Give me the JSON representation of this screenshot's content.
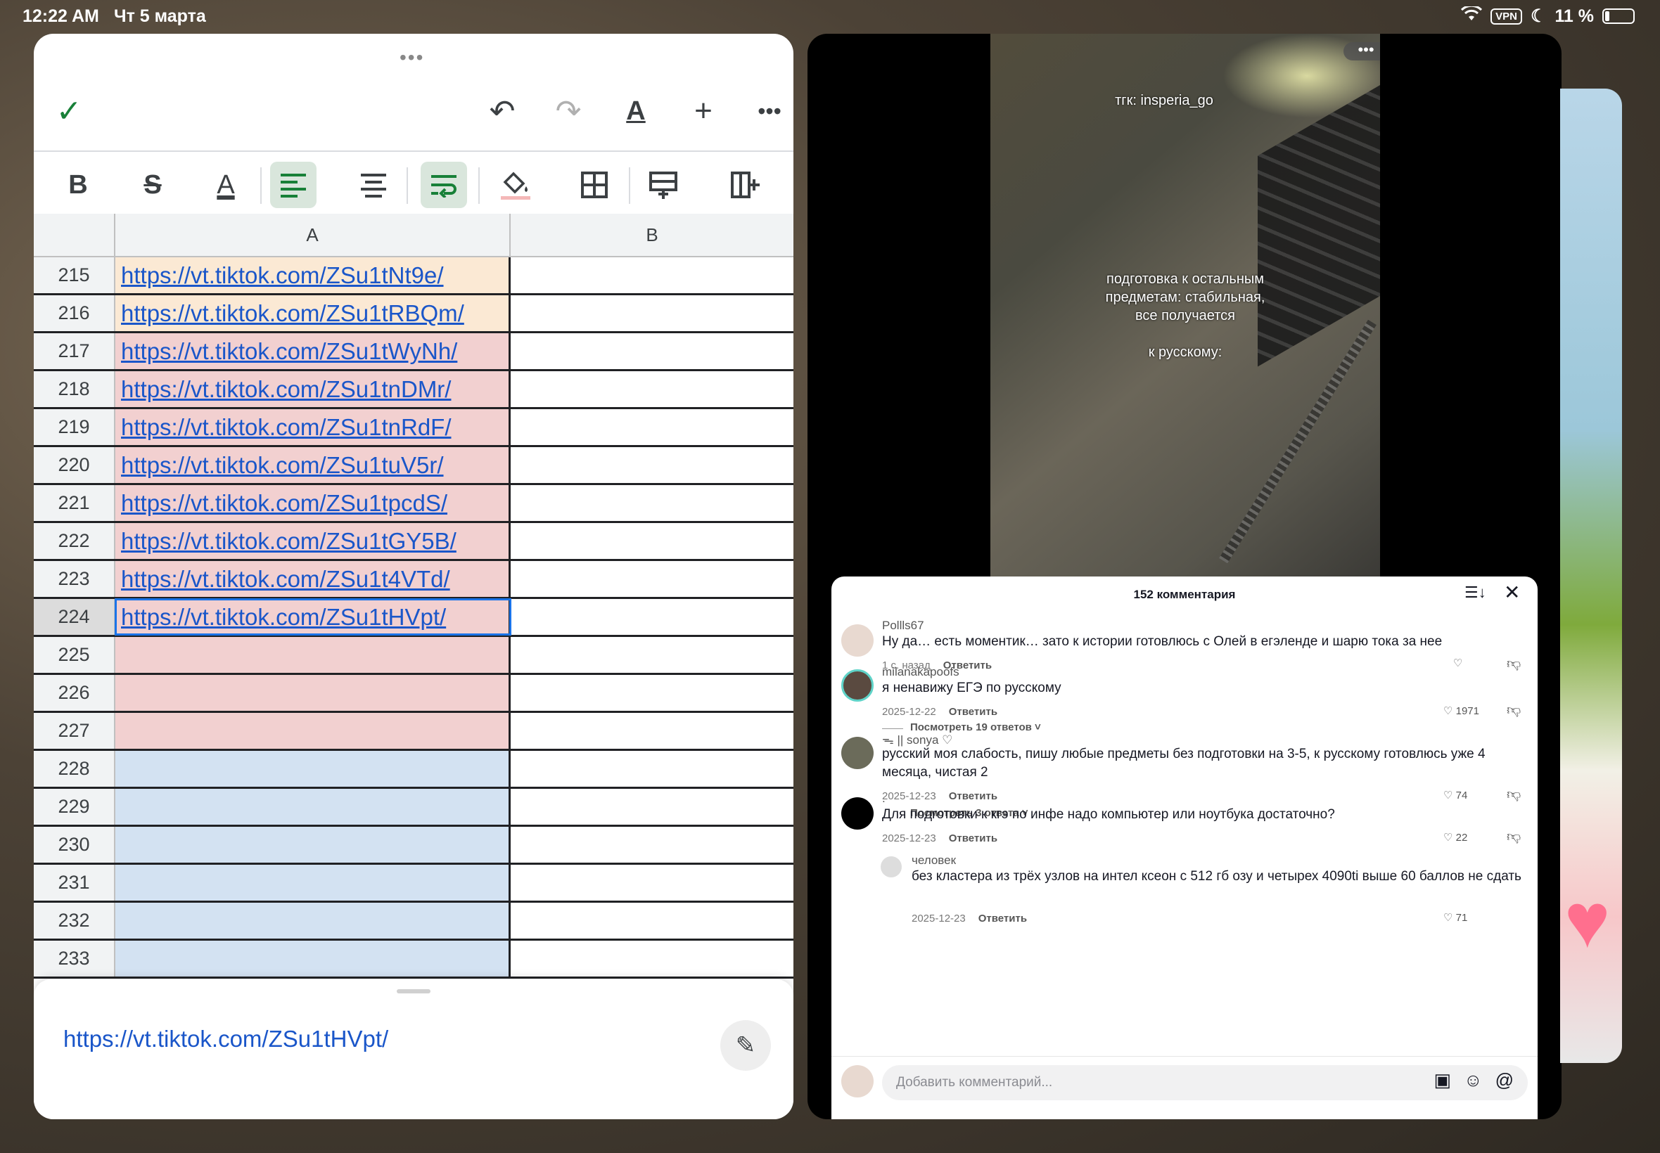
{
  "status": {
    "time": "12:22 AM",
    "date": "Чт 5 марта",
    "vpn": "VPN",
    "battery": "11 %"
  },
  "sheet": {
    "col_a": "A",
    "col_b": "B",
    "rows": [
      {
        "num": "215",
        "url": "https://vt.tiktok.com/ZSu1tNt9e/",
        "color": "#fbe9d4"
      },
      {
        "num": "216",
        "url": "https://vt.tiktok.com/ZSu1tRBQm/",
        "color": "#fbe9d4"
      },
      {
        "num": "217",
        "url": "https://vt.tiktok.com/ZSu1tWyNh/",
        "color": "#f2d0d0"
      },
      {
        "num": "218",
        "url": "https://vt.tiktok.com/ZSu1tnDMr/",
        "color": "#f2d0d0"
      },
      {
        "num": "219",
        "url": "https://vt.tiktok.com/ZSu1tnRdF/",
        "color": "#f2d0d0"
      },
      {
        "num": "220",
        "url": "https://vt.tiktok.com/ZSu1tuV5r/",
        "color": "#f2d0d0"
      },
      {
        "num": "221",
        "url": "https://vt.tiktok.com/ZSu1tpcdS/",
        "color": "#f2d0d0"
      },
      {
        "num": "222",
        "url": "https://vt.tiktok.com/ZSu1tGY5B/",
        "color": "#f2d0d0"
      },
      {
        "num": "223",
        "url": "https://vt.tiktok.com/ZSu1t4VTd/",
        "color": "#f2d0d0"
      },
      {
        "num": "224",
        "url": "https://vt.tiktok.com/ZSu1tHVpt/",
        "color": "#f2d0d0"
      },
      {
        "num": "225",
        "url": "",
        "color": "#f2d0d0"
      },
      {
        "num": "226",
        "url": "",
        "color": "#f2d0d0"
      },
      {
        "num": "227",
        "url": "",
        "color": "#f2d0d0"
      },
      {
        "num": "228",
        "url": "",
        "color": "#d3e2f2"
      },
      {
        "num": "229",
        "url": "",
        "color": "#d3e2f2"
      },
      {
        "num": "230",
        "url": "",
        "color": "#d3e2f2"
      },
      {
        "num": "231",
        "url": "",
        "color": "#d3e2f2"
      },
      {
        "num": "232",
        "url": "",
        "color": "#d3e2f2"
      },
      {
        "num": "233",
        "url": "",
        "color": "#d3e2f2"
      }
    ],
    "selected_row": "224",
    "cell_value": "https://vt.tiktok.com/ZSu1tHVpt/"
  },
  "video": {
    "watermark": "тгк: insperia_go",
    "caption_line1": "подготовка к остальным",
    "caption_line2": "предметам: стабильная,",
    "caption_line3": "все получается",
    "caption_line4": "к русскому:"
  },
  "comments": {
    "title": "152 комментария",
    "input_placeholder": "Добавить комментарий...",
    "reply_label": "Ответить",
    "items": [
      {
        "user": "Pollls67",
        "text": "Ну да… есть моментик… зато к истории готовлюсь с Олей в егэленде и шарю тока за нее",
        "date": "1 с. назад",
        "likes": ""
      },
      {
        "user": "milanakapoofs",
        "text": "я ненавижу ЕГЭ по русскому",
        "date": "2025-12-22",
        "likes": "1971",
        "more": "Посмотреть 19 ответов"
      },
      {
        "user": "ᯓ || sonya ♡",
        "text": "русский моя слабость, пишу любые предметы без подготовки на 3-5, к русскому готовлюсь уже 4 месяца, чистая 2",
        "date": "2025-12-23",
        "likes": "74",
        "more": "Посмотреть 3 ответа"
      },
      {
        "user": ".",
        "text": "Для подготовки к кгэ по инфе надо компьютер или ноутбука достаточно?",
        "date": "2025-12-23",
        "likes": "22"
      },
      {
        "user": "человек",
        "text": "без кластера из трёх узлов на интел ксеон с 512 гб озу и четырех 4090ti выше 60 баллов не сдать",
        "date": "2025-12-23",
        "likes": "71"
      }
    ]
  }
}
